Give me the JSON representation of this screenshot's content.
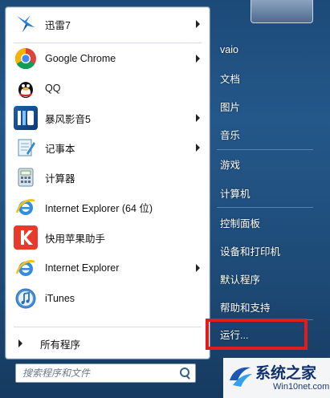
{
  "start_menu": {
    "programs": [
      {
        "label": "迅雷7",
        "icon": "thunder-bird-icon",
        "has_submenu": true
      },
      {
        "label": "Google Chrome",
        "icon": "chrome-icon",
        "has_submenu": true
      },
      {
        "label": "QQ",
        "icon": "qq-penguin-icon",
        "has_submenu": false
      },
      {
        "label": "暴风影音5",
        "icon": "baofeng-player-icon",
        "has_submenu": true
      },
      {
        "label": "记事本",
        "icon": "notepad-icon",
        "has_submenu": true
      },
      {
        "label": "计算器",
        "icon": "calculator-icon",
        "has_submenu": false
      },
      {
        "label": "Internet Explorer (64 位)",
        "icon": "internet-explorer-icon",
        "has_submenu": false
      },
      {
        "label": "快用苹果助手",
        "icon": "kuaiyong-icon",
        "has_submenu": false
      },
      {
        "label": "Internet Explorer",
        "icon": "internet-explorer-icon",
        "has_submenu": true
      },
      {
        "label": "iTunes",
        "icon": "itunes-icon",
        "has_submenu": false
      }
    ],
    "all_programs": "所有程序",
    "search_placeholder": "搜索程序和文件",
    "right_items": [
      "vaio",
      "文档",
      "图片",
      "音乐",
      "游戏",
      "计算机",
      "控制面板",
      "设备和打印机",
      "默认程序",
      "帮助和支持",
      "运行..."
    ],
    "highlighted_item": "运行..."
  },
  "watermark": {
    "title": "系统之家",
    "subtitle": "Win10net.com"
  },
  "colors": {
    "highlight_border": "#e01c1c",
    "menu_background": "#1f4f80"
  }
}
